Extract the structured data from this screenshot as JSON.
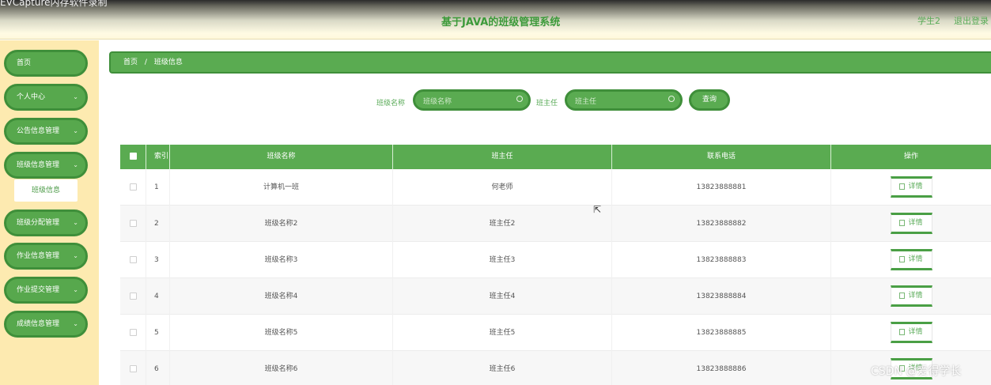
{
  "overlay": {
    "text": "EVCapture内存软件录制"
  },
  "header": {
    "title": "基于JAVA的班级管理系统",
    "user": "学生2",
    "logout": "退出登录"
  },
  "sidebar": {
    "items": [
      {
        "label": "首页",
        "has_chevron": false,
        "chevron": ""
      },
      {
        "label": "个人中心",
        "has_chevron": true,
        "chevron": "⌄"
      },
      {
        "label": "公告信息管理",
        "has_chevron": true,
        "chevron": "⌄"
      },
      {
        "label": "班级信息管理",
        "has_chevron": true,
        "chevron": "⌄"
      },
      {
        "label": "班级分配管理",
        "has_chevron": true,
        "chevron": "⌄"
      },
      {
        "label": "作业信息管理",
        "has_chevron": true,
        "chevron": "⌄"
      },
      {
        "label": "作业提交管理",
        "has_chevron": true,
        "chevron": "⌄"
      },
      {
        "label": "成绩信息管理",
        "has_chevron": true,
        "chevron": "⌄"
      }
    ],
    "submenu": {
      "label": "班级信息"
    }
  },
  "breadcrumb": {
    "home": "首页",
    "sep": "/",
    "current": "班级信息"
  },
  "search": {
    "fields": [
      {
        "label": "班级名称",
        "placeholder": "班级名称"
      },
      {
        "label": "班主任",
        "placeholder": "班主任"
      }
    ],
    "button": "查询"
  },
  "table": {
    "headers": [
      "索引",
      "班级名称",
      "班主任",
      "联系电话",
      "操作"
    ],
    "rows": [
      {
        "index": "1",
        "name": "计算机一班",
        "teacher": "何老师",
        "phone": "13823888881",
        "action": "详情"
      },
      {
        "index": "2",
        "name": "班级名称2",
        "teacher": "班主任2",
        "phone": "13823888882",
        "action": "详情"
      },
      {
        "index": "3",
        "name": "班级名称3",
        "teacher": "班主任3",
        "phone": "13823888883",
        "action": "详情"
      },
      {
        "index": "4",
        "name": "班级名称4",
        "teacher": "班主任4",
        "phone": "13823888884",
        "action": "详情"
      },
      {
        "index": "5",
        "name": "班级名称5",
        "teacher": "班主任5",
        "phone": "13823888885",
        "action": "详情"
      },
      {
        "index": "6",
        "name": "班级名称6",
        "teacher": "班主任6",
        "phone": "13823888886",
        "action": "详情"
      }
    ]
  },
  "watermark": "CSDN @爱得学长",
  "colors": {
    "accent": "#5aab51",
    "accent_dark": "#3f8f3a",
    "sidebar_bg": "#fdeab0"
  }
}
